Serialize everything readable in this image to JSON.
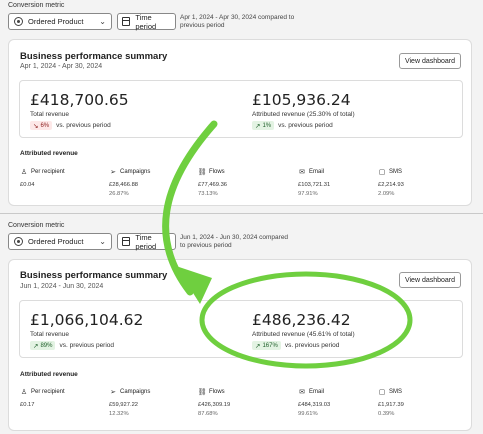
{
  "top": {
    "metric_label": "Conversion metric",
    "metric_value": "Ordered Product",
    "time_button": "Time period",
    "date_note": "Apr 1, 2024 - Apr 30, 2024 compared to previous period",
    "card": {
      "title": "Business performance summary",
      "subtitle": "Apr 1, 2024 - Apr 30, 2024",
      "view_button": "View dashboard",
      "total_revenue": "£418,700.65",
      "total_label": "Total revenue",
      "total_change": "6%",
      "total_compare": "vs. previous period",
      "attributed_revenue": "£105,936.24",
      "attributed_label": "Attributed revenue (25.30% of total)",
      "attributed_change": "1%",
      "attributed_compare": "vs. previous period",
      "attr_title": "Attributed revenue",
      "columns": [
        {
          "label": "Per recipient",
          "value": "£0.04",
          "pct": "",
          "icon": "person-icon"
        },
        {
          "label": "Campaigns",
          "value": "£28,466.88",
          "pct": "26.87%",
          "icon": "send-icon"
        },
        {
          "label": "Flows",
          "value": "£77,469.36",
          "pct": "73.13%",
          "icon": "flows-icon"
        },
        {
          "label": "Email",
          "value": "£103,721.31",
          "pct": "97.91%",
          "icon": "email-icon"
        },
        {
          "label": "SMS",
          "value": "£2,214.93",
          "pct": "2.09%",
          "icon": "sms-icon"
        }
      ]
    }
  },
  "bottom": {
    "metric_label": "Conversion metric",
    "metric_value": "Ordered Product",
    "time_button": "Time period",
    "date_note": "Jun 1, 2024 - Jun 30, 2024 compared to previous period",
    "card": {
      "title": "Business performance summary",
      "subtitle": "Jun 1, 2024 - Jun 30, 2024",
      "view_button": "View dashboard",
      "total_revenue": "£1,066,104.62",
      "total_label": "Total revenue",
      "total_change": "89%",
      "total_compare": "vs. previous period",
      "attributed_revenue": "£486,236.42",
      "attributed_label": "Attributed revenue (45.61% of total)",
      "attributed_change": "167%",
      "attributed_compare": "vs. previous period",
      "attr_title": "Attributed revenue",
      "columns": [
        {
          "label": "Per recipient",
          "value": "£0.17",
          "pct": "",
          "icon": "person-icon"
        },
        {
          "label": "Campaigns",
          "value": "£59,927.22",
          "pct": "12.32%",
          "icon": "send-icon"
        },
        {
          "label": "Flows",
          "value": "£426,309.19",
          "pct": "87.68%",
          "icon": "flows-icon"
        },
        {
          "label": "Email",
          "value": "£484,319.03",
          "pct": "99.61%",
          "icon": "email-icon"
        },
        {
          "label": "SMS",
          "value": "£1,917.39",
          "pct": "0.39%",
          "icon": "sms-icon"
        }
      ]
    }
  },
  "colors": {
    "highlight": "#6fcf3f",
    "up_badge": "#e3f3e3",
    "down_badge": "#fde8e8"
  }
}
